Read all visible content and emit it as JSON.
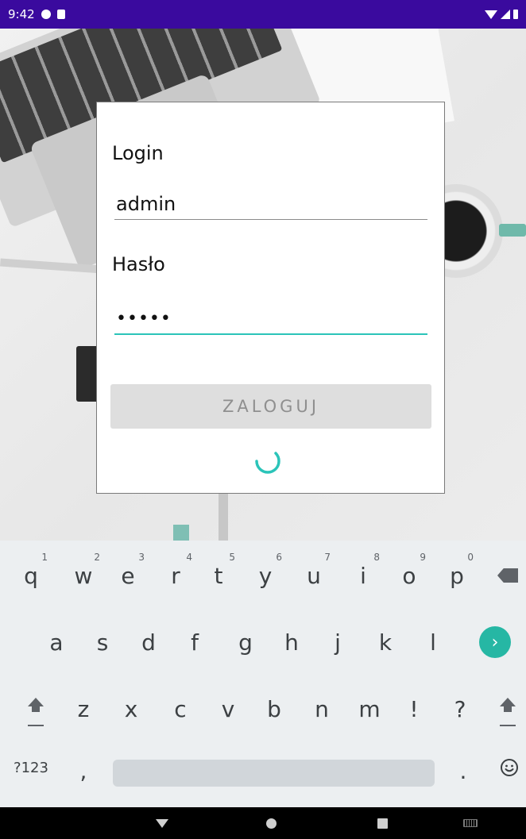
{
  "status_bar": {
    "time": "9:42",
    "icons": [
      "sync-icon",
      "sd-card-icon",
      "wifi-icon",
      "signal-icon",
      "battery-icon"
    ]
  },
  "login_form": {
    "login_label": "Login",
    "login_value": "admin",
    "password_label": "Hasło",
    "password_value": "•••••",
    "submit_label": "ZALOGUJ",
    "loading": true,
    "accent_color": "#2bc4b9"
  },
  "keyboard": {
    "row1": [
      {
        "key": "q",
        "hint": "1"
      },
      {
        "key": "w",
        "hint": "2"
      },
      {
        "key": "e",
        "hint": "3"
      },
      {
        "key": "r",
        "hint": "4"
      },
      {
        "key": "t",
        "hint": "5"
      },
      {
        "key": "y",
        "hint": "6"
      },
      {
        "key": "u",
        "hint": "7"
      },
      {
        "key": "i",
        "hint": "8"
      },
      {
        "key": "o",
        "hint": "9"
      },
      {
        "key": "p",
        "hint": "0"
      }
    ],
    "row2": [
      "a",
      "s",
      "d",
      "f",
      "g",
      "h",
      "j",
      "k",
      "l"
    ],
    "row3": [
      "z",
      "x",
      "c",
      "v",
      "b",
      "n",
      "m",
      "!",
      "?"
    ],
    "row4": {
      "symbols": "?123",
      "comma": ",",
      "period": "."
    },
    "enter_color": "#26b7a4"
  }
}
